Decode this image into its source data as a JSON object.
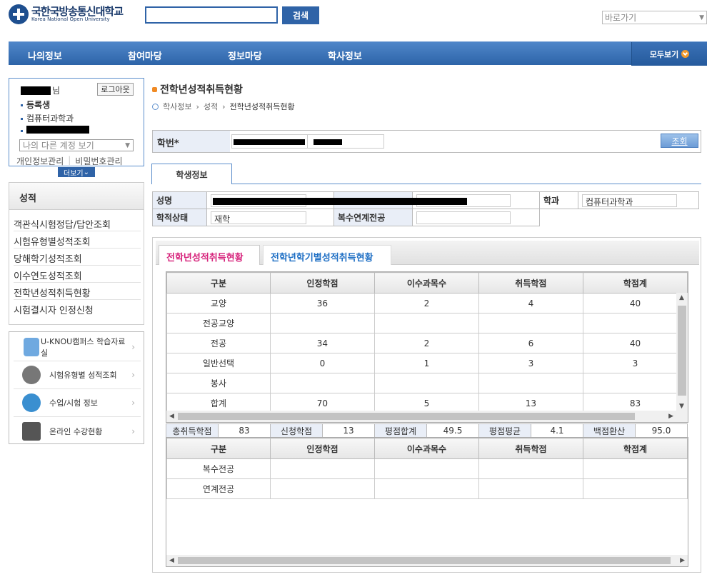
{
  "header": {
    "logo_kr": "국한국방송통신대학교",
    "logo_en": "Korea National Open University",
    "search_placeholder": "",
    "search_button": "검색",
    "goto_select": "바로가기"
  },
  "nav": {
    "items": [
      "나의정보",
      "참여마당",
      "정보마당",
      "학사정보"
    ],
    "all_label": "모두보기"
  },
  "user": {
    "name_suffix": "님",
    "logout": "로그아웃",
    "status": "등록생",
    "department": "컴퓨터과학과",
    "account_select": "나의 다른 계정 보기",
    "link_profile": "개인정보관리",
    "link_password": "비밀번호관리",
    "more": "더보기"
  },
  "left_menu": {
    "title": "성적",
    "items": [
      "객관식시험정답/답안조회",
      "시험유형별성적조회",
      "당해학기성적조회",
      "이수연도성적조회",
      "전학년성적취득현황",
      "시험결시자 인정신청"
    ]
  },
  "quick_links": [
    {
      "label": "U-KNOU캠퍼스 학습자료실",
      "icon": "u-knou-logo-icon"
    },
    {
      "label": "시험유형별 성적조회",
      "icon": "exam-icon"
    },
    {
      "label": "수업/시험 정보",
      "icon": "headset-icon"
    },
    {
      "label": "온라인 수강현황",
      "icon": "monitor-icon"
    }
  ],
  "page": {
    "title": "전학년성적취득현황",
    "breadcrumb": [
      "학사정보",
      "성적",
      "전학년성적취득현황"
    ]
  },
  "student_search": {
    "label": "학번*",
    "query_button": "조회"
  },
  "student_tab": "학생정보",
  "student_info": {
    "name_label": "성명",
    "dept_label": "학과",
    "dept_value": "컴퓨터과학과",
    "status_label": "학적상태",
    "status_value": "재학",
    "double_major_label": "복수연계전공",
    "double_major_value": ""
  },
  "grade_tabs": {
    "active": "전학년성적취득현황",
    "inactive": "전학년학기별성적취득현황"
  },
  "grid1": {
    "headers": [
      "구분",
      "인정학점",
      "이수과목수",
      "취득학점",
      "학점계"
    ],
    "rows": [
      [
        "교양",
        "36",
        "2",
        "4",
        "40"
      ],
      [
        "전공교양",
        "",
        "",
        "",
        ""
      ],
      [
        "전공",
        "34",
        "2",
        "6",
        "40"
      ],
      [
        "일반선택",
        "0",
        "1",
        "3",
        "3"
      ],
      [
        "봉사",
        "",
        "",
        "",
        ""
      ],
      [
        "합계",
        "70",
        "5",
        "13",
        "83"
      ]
    ]
  },
  "summary": [
    {
      "label": "총취득학점",
      "value": "83"
    },
    {
      "label": "신청학점",
      "value": "13"
    },
    {
      "label": "평점합계",
      "value": "49.5"
    },
    {
      "label": "평점평균",
      "value": "4.1"
    },
    {
      "label": "백점환산",
      "value": "95.0"
    }
  ],
  "grid2": {
    "headers": [
      "구분",
      "인정학점",
      "이수과목수",
      "취득학점",
      "학점계"
    ],
    "rows": [
      [
        "복수전공",
        "",
        "",
        "",
        ""
      ],
      [
        "연계전공",
        "",
        "",
        "",
        ""
      ]
    ]
  }
}
